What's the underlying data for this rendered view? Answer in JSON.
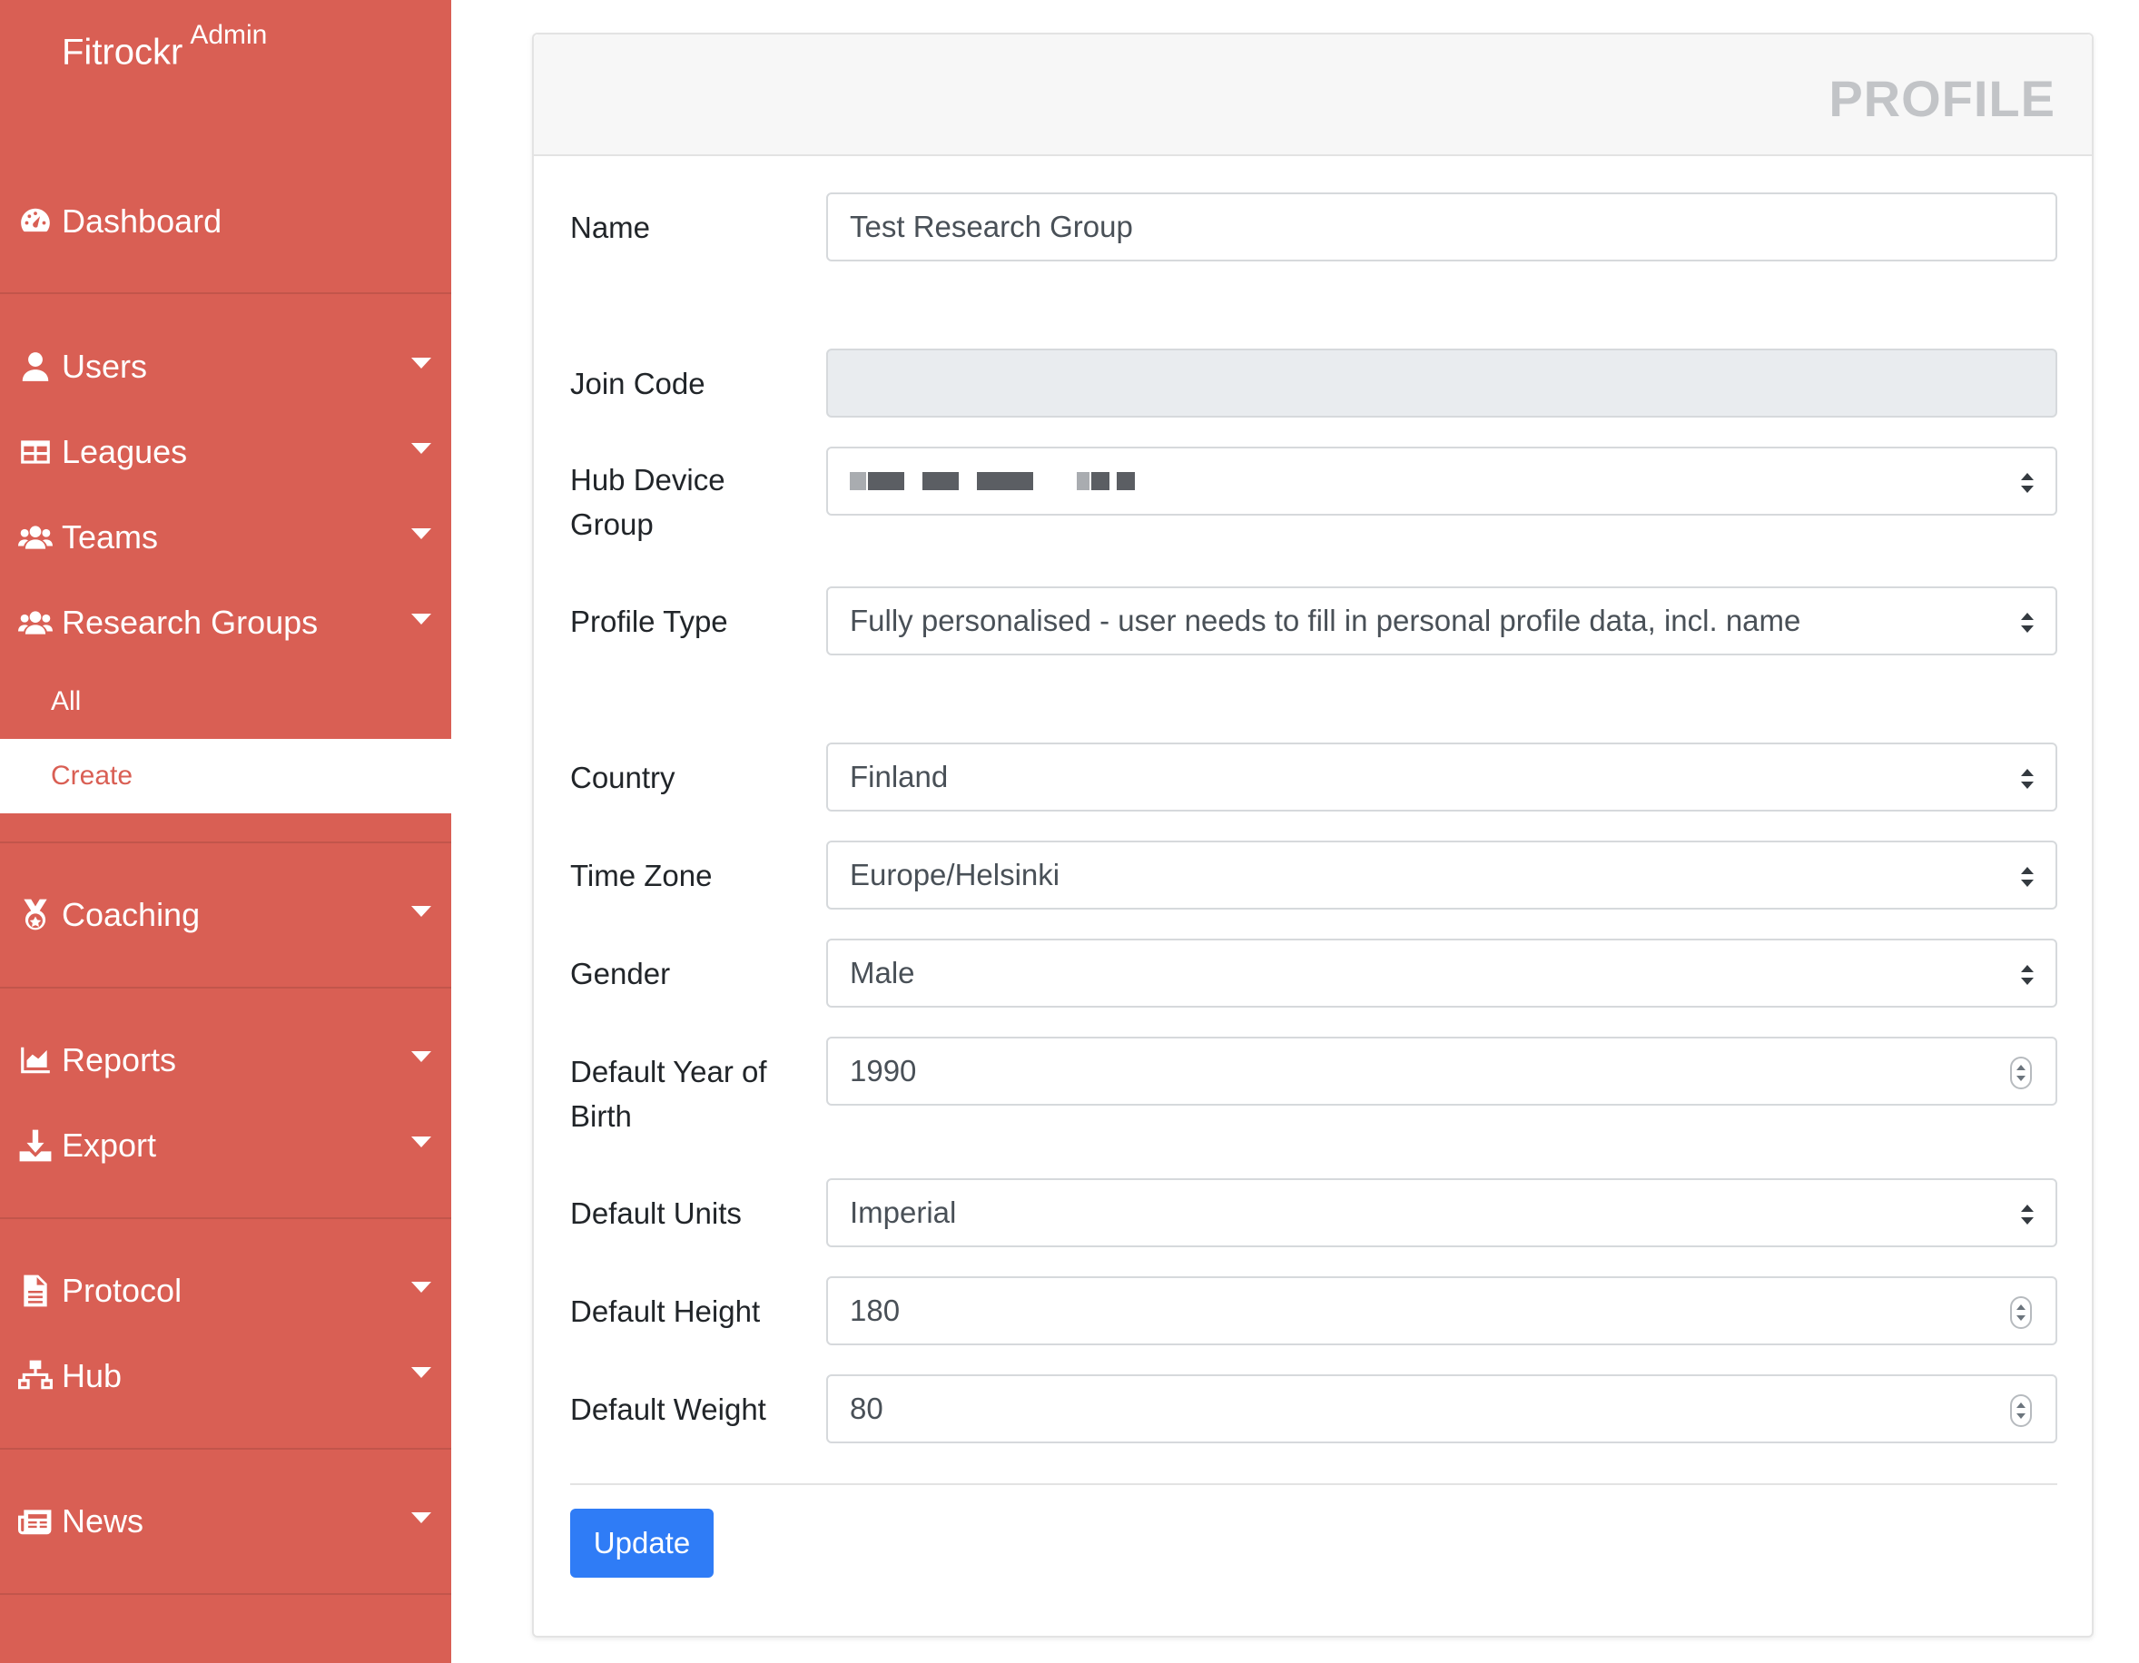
{
  "brand": {
    "name": "Fitrockr",
    "suffix": "Admin"
  },
  "sidebar": {
    "items": [
      {
        "label": "Dashboard",
        "icon": "dashboard-icon"
      },
      {
        "label": "Users",
        "icon": "user-icon"
      },
      {
        "label": "Leagues",
        "icon": "table-icon"
      },
      {
        "label": "Teams",
        "icon": "users-icon"
      },
      {
        "label": "Research Groups",
        "icon": "users-icon"
      },
      {
        "label": "Coaching",
        "icon": "medal-icon"
      },
      {
        "label": "Reports",
        "icon": "chart-area-icon"
      },
      {
        "label": "Export",
        "icon": "download-icon"
      },
      {
        "label": "Protocol",
        "icon": "file-icon"
      },
      {
        "label": "Hub",
        "icon": "sitemap-icon"
      },
      {
        "label": "News",
        "icon": "newspaper-icon"
      }
    ],
    "research_groups_sub": [
      {
        "label": "All"
      },
      {
        "label": "Create",
        "active": true
      }
    ]
  },
  "card": {
    "title": "PROFILE"
  },
  "form": {
    "name": {
      "label": "Name",
      "value": "Test Research Group"
    },
    "join_code": {
      "label": "Join Code",
      "value": ""
    },
    "hub_device_group": {
      "label": "Hub Device Group",
      "value": ""
    },
    "profile_type": {
      "label": "Profile Type",
      "value": "Fully personalised - user needs to fill in personal profile data, incl. name"
    },
    "country": {
      "label": "Country",
      "value": "Finland"
    },
    "time_zone": {
      "label": "Time Zone",
      "value": "Europe/Helsinki"
    },
    "gender": {
      "label": "Gender",
      "value": "Male"
    },
    "year_of_birth": {
      "label": "Default Year of Birth",
      "value": "1990"
    },
    "units": {
      "label": "Default Units",
      "value": "Imperial"
    },
    "height": {
      "label": "Default Height",
      "value": "180"
    },
    "weight": {
      "label": "Default Weight",
      "value": "80"
    }
  },
  "actions": {
    "update_label": "Update"
  },
  "colors": {
    "sidebar_bg": "#d95f54",
    "primary_button": "#2f7cf6",
    "active_sub_text": "#d95f54"
  }
}
